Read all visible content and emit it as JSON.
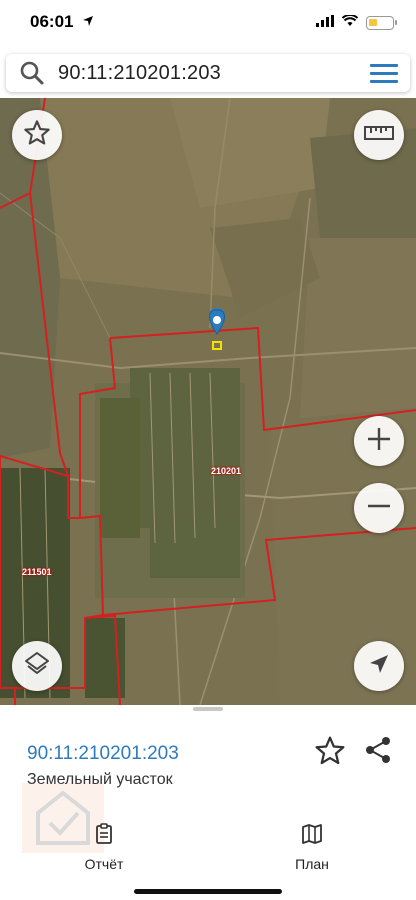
{
  "status": {
    "time": "06:01"
  },
  "search": {
    "query": "90:11:210201:203"
  },
  "map": {
    "labels": {
      "parcel_main": "210201",
      "parcel_left": "211501"
    }
  },
  "sheet": {
    "parcel_id": "90:11:210201:203",
    "parcel_type": "Земельный участок",
    "tabs": [
      {
        "label": "Отчёт",
        "icon": "report-icon"
      },
      {
        "label": "План",
        "icon": "map-plan-icon"
      }
    ]
  },
  "colors": {
    "accent": "#2d7bbf",
    "boundary": "#d42020",
    "pin": "#2d7bbf",
    "battery": "#f5c542"
  }
}
